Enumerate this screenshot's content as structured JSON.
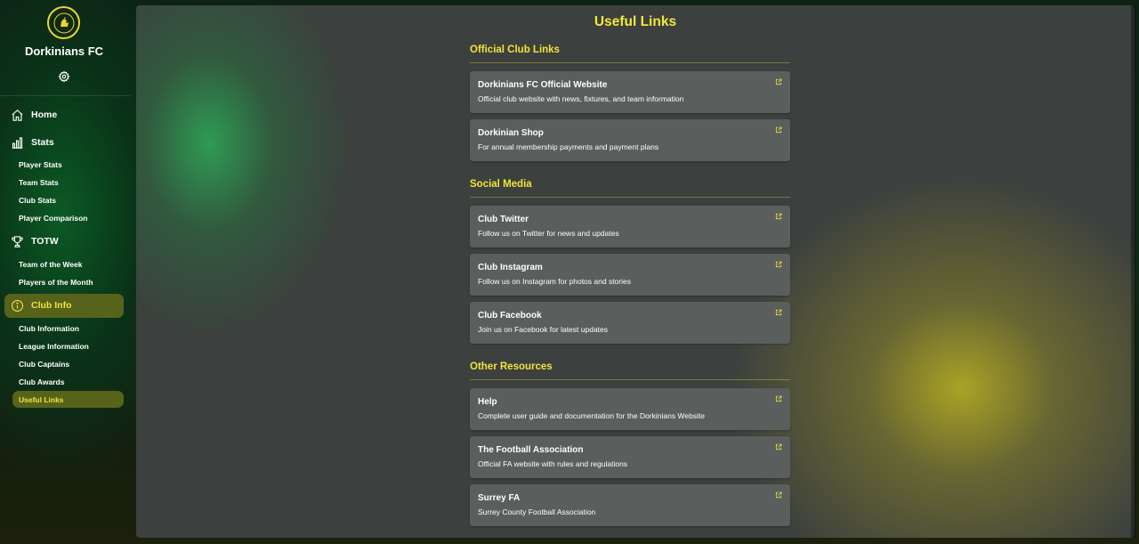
{
  "sidebar": {
    "club_name": "Dorkinians FC",
    "settings_icon": "gear-icon",
    "items": [
      {
        "label": "Home",
        "icon": "home-icon"
      },
      {
        "label": "Stats",
        "icon": "bar-chart-icon",
        "subitems": [
          "Player Stats",
          "Team Stats",
          "Club Stats",
          "Player Comparison"
        ]
      },
      {
        "label": "TOTW",
        "icon": "trophy-icon",
        "subitems": [
          "Team of the Week",
          "Players of the Month"
        ]
      },
      {
        "label": "Club Info",
        "icon": "info-icon",
        "active": true,
        "subitems": [
          "Club Information",
          "League Information",
          "Club Captains",
          "Club Awards",
          "Useful Links"
        ],
        "active_subitem": "Useful Links"
      }
    ]
  },
  "main": {
    "title": "Useful Links",
    "sections": [
      {
        "title": "Official Club Links",
        "links": [
          {
            "title": "Dorkinians FC Official Website",
            "desc": "Official club website with news, fixtures, and team information"
          },
          {
            "title": "Dorkinian Shop",
            "desc": "For annual membership payments and payment plans"
          }
        ]
      },
      {
        "title": "Social Media",
        "links": [
          {
            "title": "Club Twitter",
            "desc": "Follow us on Twitter for news and updates"
          },
          {
            "title": "Club Instagram",
            "desc": "Follow us on Instagram for photos and stories"
          },
          {
            "title": "Club Facebook",
            "desc": "Join us on Facebook for latest updates"
          }
        ]
      },
      {
        "title": "Other Resources",
        "links": [
          {
            "title": "Help",
            "desc": "Complete user guide and documentation for the Dorkinians Website"
          },
          {
            "title": "The Football Association",
            "desc": "Official FA website with rules and regulations"
          },
          {
            "title": "Surrey FA",
            "desc": "Surrey County Football Association"
          }
        ]
      }
    ]
  },
  "colors": {
    "accent_yellow": "#f0e33a",
    "active_bg": "#57621b",
    "card_bg": "#5a5e5d"
  }
}
